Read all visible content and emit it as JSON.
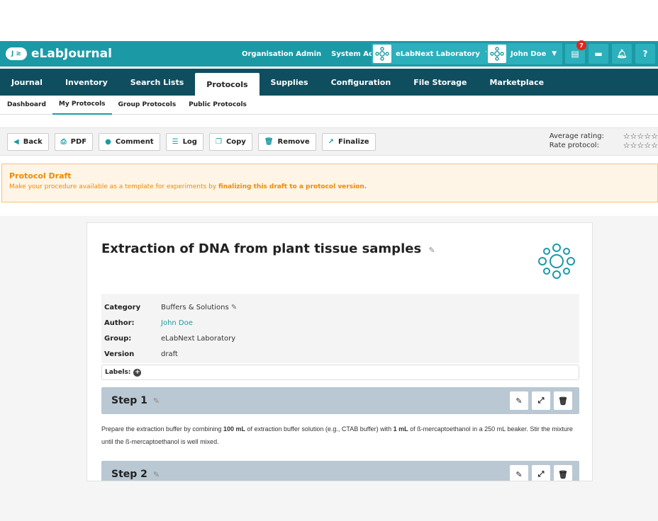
{
  "app": {
    "logo_badge": "J ≥",
    "logo_text": "eLabJournal"
  },
  "topbar": {
    "links": [
      "Organisation Admin",
      "System Admin"
    ],
    "lab_chip": "eLabNext Laboratory",
    "user_chip": "John Doe",
    "notification_count": "7",
    "help_label": "?"
  },
  "mainnav": {
    "items": [
      {
        "label": "Journal"
      },
      {
        "label": "Inventory"
      },
      {
        "label": "Search Lists"
      },
      {
        "label": "Protocols"
      },
      {
        "label": "Supplies"
      },
      {
        "label": "Configuration"
      },
      {
        "label": "File Storage"
      },
      {
        "label": "Marketplace"
      }
    ],
    "active": "Protocols"
  },
  "subnav": {
    "items": [
      {
        "label": "Dashboard"
      },
      {
        "label": "My Protocols"
      },
      {
        "label": "Group Protocols"
      },
      {
        "label": "Public Protocols"
      }
    ],
    "active": "My Protocols"
  },
  "toolbar": {
    "buttons": [
      {
        "label": "Back",
        "icon": "back-icon"
      },
      {
        "label": "PDF",
        "icon": "print-icon"
      },
      {
        "label": "Comment",
        "icon": "comment-icon"
      },
      {
        "label": "Log",
        "icon": "list-icon"
      },
      {
        "label": "Copy",
        "icon": "copy-icon"
      },
      {
        "label": "Remove",
        "icon": "trash-icon"
      },
      {
        "label": "Finalize",
        "icon": "export-icon"
      }
    ],
    "average_rating_label": "Average rating:",
    "rate_protocol_label": "Rate protocol:",
    "stars": "☆☆☆☆☆"
  },
  "draft": {
    "title": "Protocol Draft",
    "text_prefix": "Make your procedure available as a template for experiments by ",
    "text_link": "finalizing this draft to a protocol version."
  },
  "protocol": {
    "title": "Extraction of DNA from plant tissue samples",
    "meta": [
      {
        "key": "Category",
        "value": "Buffers & Solutions"
      },
      {
        "key": "Author:",
        "value": "John Doe"
      },
      {
        "key": "Group:",
        "value": "eLabNext Laboratory"
      },
      {
        "key": "Version",
        "value": "draft"
      }
    ],
    "labels_label": "Labels:",
    "steps": [
      {
        "title": "Step 1",
        "text_a": "Prepare the extraction buffer by combining ",
        "text_b": "100 mL",
        "text_c": " of extraction buffer solution (e.g., CTAB buffer) with ",
        "text_d": "1 mL",
        "text_e": " of ß-mercaptoethanol in a 250 mL beaker. Stir the mixture until the ß-mercaptoethanol is well mixed."
      },
      {
        "title": "Step 2"
      }
    ]
  },
  "colors": {
    "teal": "#1b9aa6",
    "dark_nav": "#0e4e5e",
    "draft_orange": "#ef8a00",
    "step_bar": "#b9c8d3",
    "badge_red": "#e0261d"
  }
}
